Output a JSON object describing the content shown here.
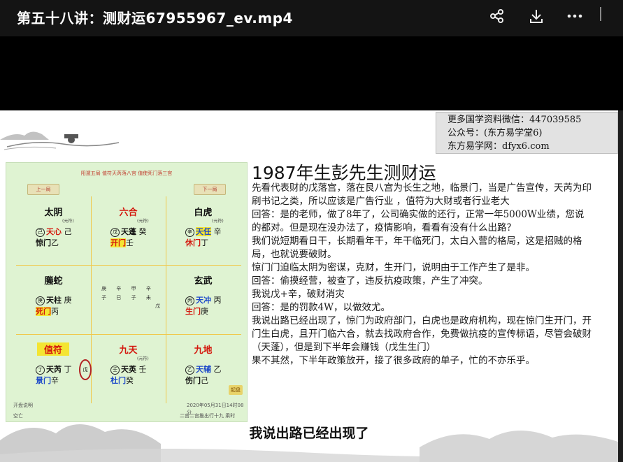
{
  "window": {
    "title": "第五十八讲：测财运67955967_ev.mp4",
    "icons": [
      "share-icon",
      "download-icon",
      "more-icon"
    ]
  },
  "banner": {
    "lines": [
      "更多国学资料微信：447039585",
      "公众号：(东方易学堂6)",
      "东方易学网：dfyx6.com"
    ]
  },
  "board": {
    "header": "阳遁五局 值符天芮落八宫 值使死门落三宫",
    "prev": "上一局",
    "next": "下一局",
    "center_chars": [
      "庚 辛 甲 辛",
      "子 巳 子 未"
    ],
    "center_corner": "戊",
    "oval_char": "戊",
    "palaces": [
      {
        "god": "太阴",
        "mini": "(元符)",
        "r1_star": "天心",
        "r1_stem": "己",
        "r1_door": "惊门",
        "r2_stem": "乙",
        "god_red": false,
        "star_color": "red"
      },
      {
        "god": "六合",
        "mini": "(元符)",
        "r1_star": "天蓬",
        "r1_stem": "癸",
        "r1_door": "开门",
        "r2_stem": "壬",
        "god_red": true,
        "star_color": "black"
      },
      {
        "god": "白虎",
        "mini": "(元符)",
        "r1_star": "天任",
        "r1_stem": "辛",
        "r1_door": "休门",
        "r2_stem": "丁",
        "god_red": false,
        "star_color": "blue"
      },
      {
        "god": "螣蛇",
        "mini": "",
        "r1_star": "天柱",
        "r1_stem": "庚",
        "r1_door": "死门",
        "r2_stem": "丙",
        "god_red": false,
        "star_color": "black"
      },
      {
        "god": "玄武",
        "mini": "",
        "r1_star": "天冲",
        "r1_stem": "丙",
        "r1_door": "生门",
        "r2_stem": "庚",
        "god_red": false,
        "star_color": "blue"
      },
      {
        "god": "值符",
        "mini": "",
        "r1_star": "天芮",
        "r1_stem": "丁",
        "r1_door": "景门",
        "r2_stem": "辛",
        "god_red": true,
        "star_color": "black"
      },
      {
        "god": "九天",
        "mini": "(元符)",
        "r1_star": "天英",
        "r1_stem": "壬",
        "r1_door": "杜门",
        "r2_stem": "癸",
        "god_red": true,
        "star_color": "black"
      },
      {
        "god": "九地",
        "mini": "",
        "r1_star": "天辅",
        "r1_stem": "乙",
        "r1_door": "伤门",
        "r2_stem": "己",
        "god_red": true,
        "star_color": "blue"
      }
    ],
    "footer_left": "开盘说明",
    "footer_left2": "空亡",
    "footer_date": "2020年05月31日14时08分",
    "footer_mid": "二宫二宫推出行十九 乘时",
    "footer_btn": "起盘"
  },
  "article": {
    "heading": "1987年生彭先生测财运",
    "paragraphs": [
      "先看代表财的戊落宫，落在艮八宫为长生之地，临景门，当是广告宣传，天芮为印刷书记之类，所以应该是广告行业 ，值符为大财或者行业老大",
      "回答：是的老师，做了8年了，公司确实做的还行，正常一年5000W业绩，您说的都对。但是现在没办法了，疫情影响，看看有没有什么出路？",
      "我们说短期看日干，长期看年干，年干临死门，太白入营的格局，这是招贼的格局，也就说要破财。",
      "惊门门迫临太阴为密谋，克财，生开门，说明由于工作产生了是非。",
      "回答：偷摸经营，被查了，违反抗疫政策，产生了冲突。",
      "我说戊+辛，破财消灾",
      "回答：是的罚款4W，以做效尤。",
      "我说出路已经出现了，惊门为政府部门，白虎也是政府机构，现在惊门生开门，开门生白虎，且开门临六合，就去找政府合作，免费做抗疫的宣传标语，尽管会破财（天蓬），但是到下半年会赚钱（戊生生门）",
      "果不其然，下半年政策放开，接了很多政府的单子，忙的不亦乐乎。"
    ]
  },
  "subtitle": "我说出路已经出现了"
}
